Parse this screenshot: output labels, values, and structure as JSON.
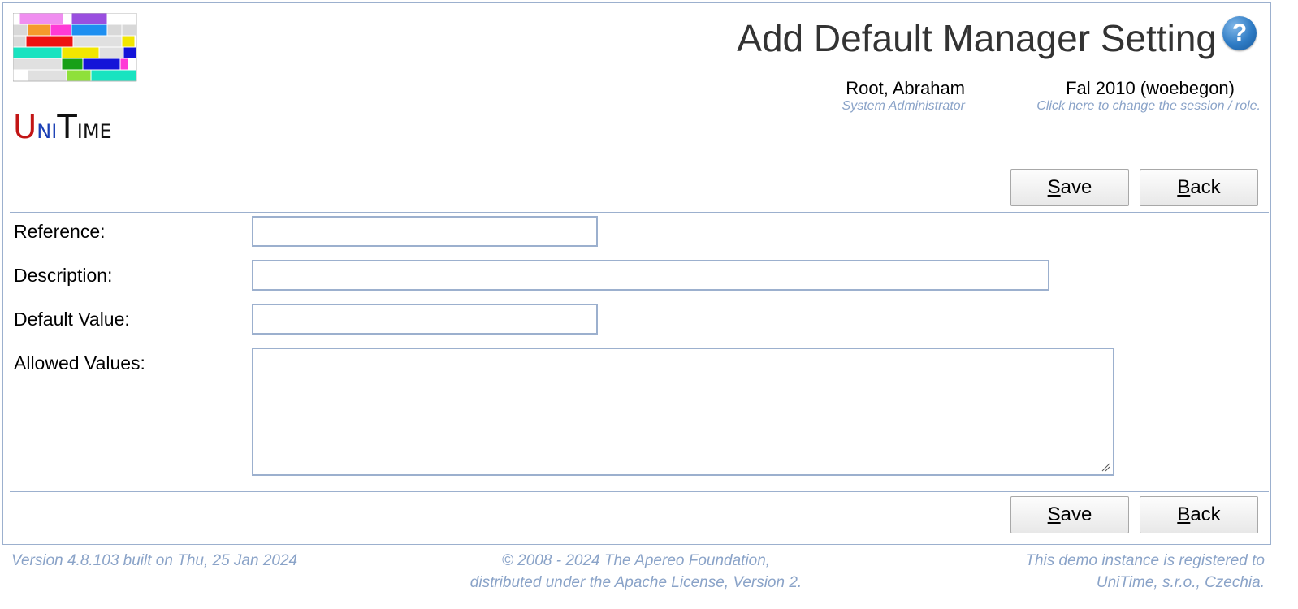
{
  "header": {
    "title": "Add Default Manager Setting",
    "help_icon": "question-mark",
    "user": {
      "name": "Root, Abraham",
      "role": "System Administrator"
    },
    "session": {
      "name": "Fal 2010 (woebegon)",
      "hint": "Click here to change the session / role."
    }
  },
  "logo": {
    "text_u": "U",
    "text_ni": "NI",
    "text_t": "T",
    "text_ime": "IME"
  },
  "buttons": {
    "save_mnemonic": "S",
    "save_rest": "ave",
    "back_mnemonic": "B",
    "back_rest": "ack"
  },
  "form": {
    "reference_label": "Reference:",
    "reference_value": "",
    "description_label": "Description:",
    "description_value": "",
    "default_value_label": "Default Value:",
    "default_value_value": "",
    "allowed_values_label": "Allowed Values:",
    "allowed_values_value": ""
  },
  "footer": {
    "version": "Version 4.8.103 built on Thu, 25 Jan 2024",
    "copyright_line1": "© 2008 - 2024 The Apereo Foundation,",
    "copyright_line2": "distributed under the Apache License, Version 2.",
    "registration_line1": "This demo instance is registered to",
    "registration_line2": "UniTime, s.r.o., Czechia."
  },
  "colors": {
    "accent": "#9cb0ce",
    "muted_text": "#8aa3c8",
    "help": "#2e7bc4"
  }
}
